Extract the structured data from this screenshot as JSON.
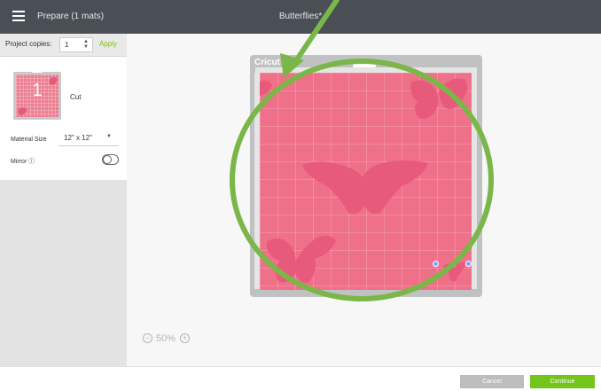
{
  "topbar": {
    "mode_title": "Prepare (1 mats)",
    "project_title": "Butterflies*"
  },
  "left_panel": {
    "copies_label": "Project copies:",
    "copies_value": "1",
    "apply_label": "Apply",
    "mat": {
      "number": "1",
      "label": "Cut"
    },
    "material_size_label": "Material Size",
    "material_size_value": "12\" x 12\"",
    "mirror_label": "Mirror ⓘ",
    "mirror_on": false
  },
  "mat": {
    "brand": "Cricut",
    "color": "#ef7089",
    "butterfly_color": "#e75a7c"
  },
  "zoom": {
    "value": "50%"
  },
  "bottombar": {
    "cancel_label": "Cancel",
    "continue_label": "Continue"
  },
  "annotation": {
    "color": "#7ab648"
  },
  "icons": [
    "hamburger-menu-icon",
    "stepper-icon",
    "caret-down-icon",
    "info-icon",
    "zoom-out-icon",
    "zoom-in-icon"
  ]
}
